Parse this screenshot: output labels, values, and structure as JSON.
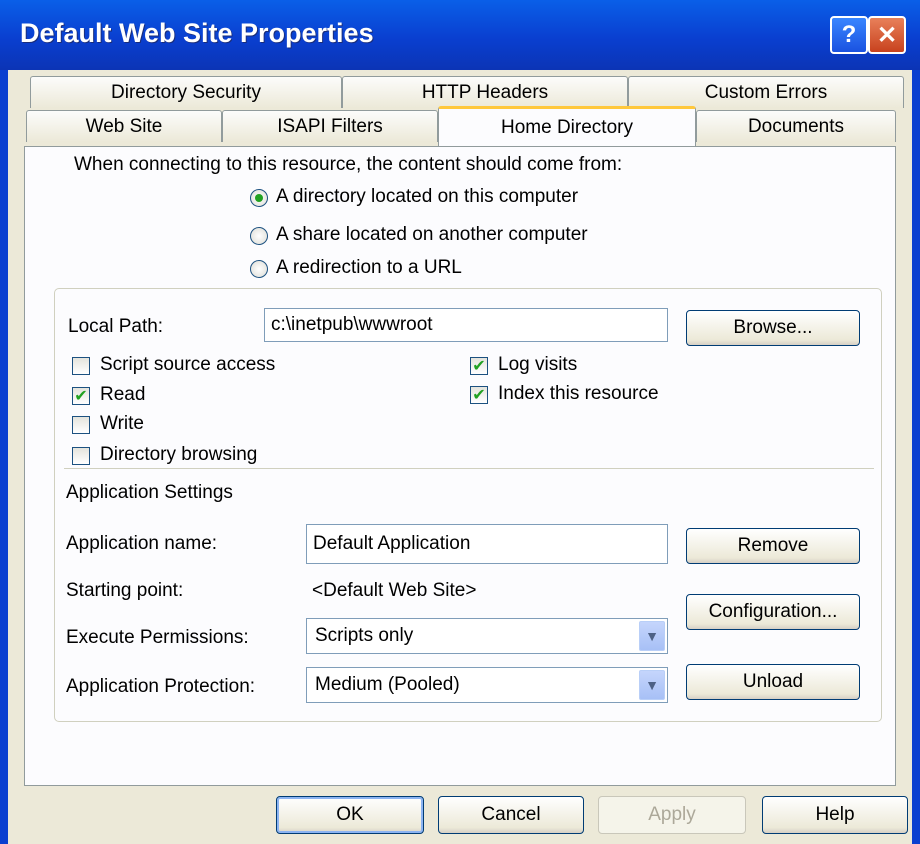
{
  "window": {
    "title": "Default Web Site Properties"
  },
  "tabs_row1": [
    "Directory Security",
    "HTTP Headers",
    "Custom Errors"
  ],
  "tabs_row2": [
    "Web Site",
    "ISAPI Filters",
    "Home Directory",
    "Documents"
  ],
  "active_tab": "Home Directory",
  "content_source": {
    "prompt": "When connecting to this resource, the content should come from:",
    "options": [
      {
        "label": "A directory located on this computer",
        "selected": true
      },
      {
        "label": "A share located on another computer",
        "selected": false
      },
      {
        "label": "A redirection to a URL",
        "selected": false
      }
    ]
  },
  "local_path": {
    "label": "Local Path:",
    "value": "c:\\inetpub\\wwwroot",
    "browse_label": "Browse..."
  },
  "checkboxes_left": [
    {
      "label": "Script source access",
      "checked": false
    },
    {
      "label": "Read",
      "checked": true
    },
    {
      "label": "Write",
      "checked": false
    },
    {
      "label": "Directory browsing",
      "checked": false
    }
  ],
  "checkboxes_right": [
    {
      "label": "Log visits",
      "checked": true
    },
    {
      "label": "Index this resource",
      "checked": true
    }
  ],
  "app_settings": {
    "heading": "Application Settings",
    "name_label": "Application name:",
    "name_value": "Default Application",
    "remove_label": "Remove",
    "starting_point_label": "Starting point:",
    "starting_point_value": "<Default Web Site>",
    "configuration_label": "Configuration...",
    "exec_label": "Execute Permissions:",
    "exec_value": "Scripts only",
    "protection_label": "Application Protection:",
    "protection_value": "Medium (Pooled)",
    "unload_label": "Unload"
  },
  "footer": {
    "ok": "OK",
    "cancel": "Cancel",
    "apply": "Apply",
    "help": "Help"
  },
  "colors": {
    "titlebar": "#0a3fd0",
    "face": "#ece9d8",
    "accent_tab": "#ffc83c",
    "check": "#21a121"
  }
}
